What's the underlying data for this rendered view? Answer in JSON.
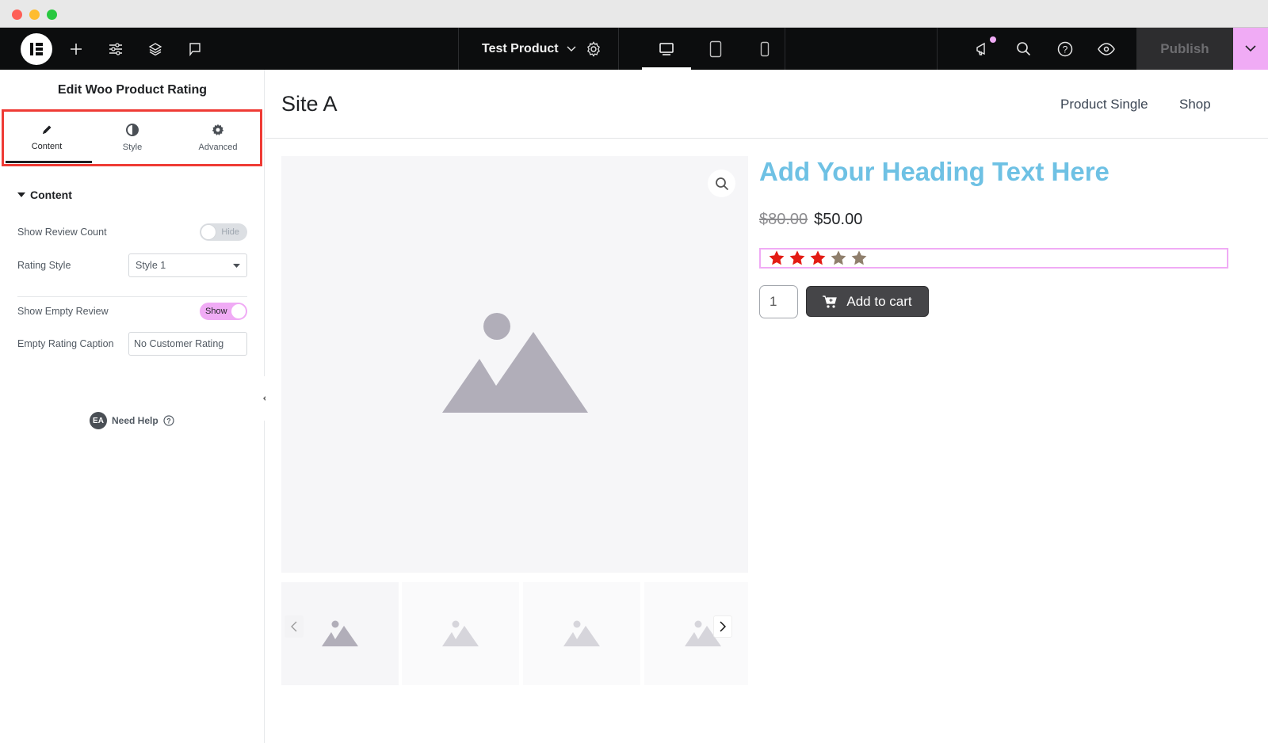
{
  "window": {
    "traffic_lights": {
      "close": "#fe5f57",
      "minimize": "#febc2e",
      "zoom": "#28c840"
    }
  },
  "topbar": {
    "logo": "elementor-logo",
    "left_icons": [
      "plus-icon",
      "sliders-icon",
      "layers-icon",
      "comment-icon"
    ],
    "document_title": "Test Product",
    "device_modes": [
      "desktop",
      "tablet",
      "mobile"
    ],
    "active_device": "desktop",
    "right_icons": [
      "megaphone-icon",
      "search-icon",
      "help-icon",
      "eye-icon"
    ],
    "publish_label": "Publish",
    "accent": "#f0abf5"
  },
  "panel": {
    "title": "Edit Woo Product Rating",
    "tabs": [
      {
        "label": "Content",
        "icon": "pencil-icon",
        "active": true
      },
      {
        "label": "Style",
        "icon": "contrast-icon",
        "active": false
      },
      {
        "label": "Advanced",
        "icon": "gear-icon",
        "active": false
      }
    ],
    "section_title": "Content",
    "controls": {
      "show_review_count": {
        "label": "Show Review Count",
        "state": "Hide"
      },
      "rating_style": {
        "label": "Rating Style",
        "value": "Style 1"
      },
      "show_empty_review": {
        "label": "Show Empty Review",
        "state": "Show"
      },
      "empty_rating_caption": {
        "label": "Empty Rating Caption",
        "value": "No Customer Rating"
      }
    },
    "help": {
      "badge": "EA",
      "label": "Need Help"
    }
  },
  "site": {
    "title": "Site A",
    "nav": [
      "Product Single",
      "Shop"
    ]
  },
  "product": {
    "heading": "Add Your Heading Text Here",
    "old_price": "$80.00",
    "price": "$50.00",
    "rating": 3,
    "rating_max": 5,
    "star_filled_color": "#e31b14",
    "star_empty_color": "#8f7f6c",
    "heading_color": "#6ec1e4",
    "quantity": "1",
    "add_to_cart_label": "Add to cart",
    "thumbnail_count": 4
  }
}
